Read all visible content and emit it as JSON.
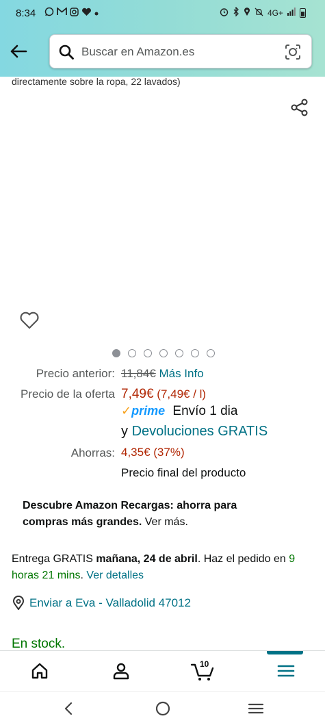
{
  "status": {
    "time": "8:34",
    "left_icons": [
      "whatsapp-icon",
      "gmail-icon",
      "instagram-icon",
      "health-icon",
      "dot-icon"
    ],
    "network": "4G+"
  },
  "search": {
    "placeholder": "Buscar en Amazon.es"
  },
  "product": {
    "title_fragment": "directamente sobre la ropa, 22 lavados)",
    "image_count": 7,
    "active_image": 0
  },
  "pricing": {
    "previous_label": "Precio anterior:",
    "previous_price": "11,84€",
    "more_info": "Más Info",
    "offer_label": "Precio de la oferta",
    "offer_price": "7,49€",
    "unit_price": "(7,49€ / l)",
    "prime": "prime",
    "shipping": "Envío 1 dia",
    "returns_prefix": "y",
    "returns_link": "Devoluciones GRATIS",
    "savings_label": "Ahorras:",
    "savings_value": "4,35€ (37%)",
    "final_note": "Precio final del producto"
  },
  "promo": {
    "bold_text": "Descubre Amazon Recargas: ahorra para compras más grandes.",
    "link_text": "Ver más."
  },
  "delivery": {
    "prefix": "Entrega GRATIS",
    "date": "mañana, 24 de abril",
    "middle": ". Haz el pedido en",
    "countdown": "9 horas 21 mins",
    "details_link": "Ver detalles"
  },
  "ship_to": {
    "text": "Enviar a Eva - Valladolid 47012"
  },
  "stock": {
    "text": "En stock."
  },
  "tabs": {
    "cart_count": "10",
    "accent": "#007185"
  }
}
